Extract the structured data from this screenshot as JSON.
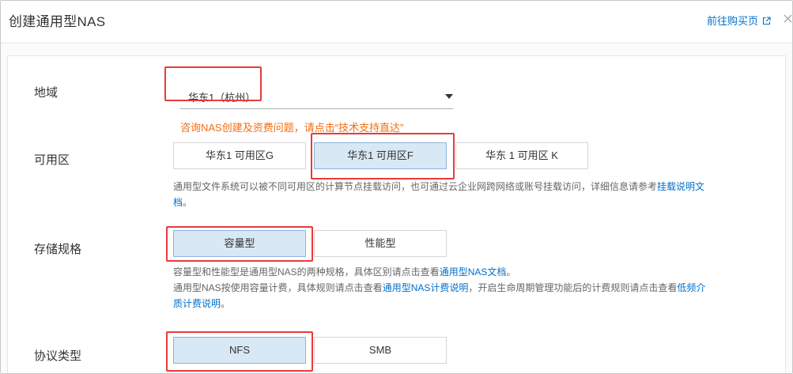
{
  "header": {
    "title": "创建通用型NAS",
    "buy_link": "前往购买页"
  },
  "region": {
    "label": "地域",
    "value": "华东1（杭州）",
    "hint": "咨询NAS创建及资费问题，请点击“技术支持直达”"
  },
  "zone": {
    "label": "可用区",
    "options": [
      "华东1 可用区G",
      "华东1 可用区F",
      "华东 1 可用区 K"
    ],
    "desc_text": "通用型文件系统可以被不同可用区的计算节点挂载访问，也可通过云企业网跨网络或账号挂载访问，详细信息请参考",
    "desc_link_1": "挂载说明文",
    "desc_link_2": "档",
    "desc_end": "。"
  },
  "storage": {
    "label": "存储规格",
    "options": [
      "容量型",
      "性能型"
    ],
    "desc1_text": "容量型和性能型是通用型NAS的两种规格，具体区别请点击查看",
    "desc1_link": "通用型NAS文档",
    "desc1_end": "。",
    "desc2_text": "通用型NAS按使用容量计费，具体规则请点击查看",
    "desc2_link": "通用型NAS计费说明",
    "desc2_mid": "，开启生命周期管理功能后的计费规则请点击查看",
    "desc2_link2a": "低频介",
    "desc2_link2b": "质计费说明",
    "desc2_end": "。"
  },
  "protocol": {
    "label": "协议类型",
    "options": [
      "NFS",
      "SMB"
    ]
  },
  "icons": {
    "external": "external-link-icon",
    "caret": "caret-down-icon",
    "close": "close-icon"
  },
  "colors": {
    "accent": "#0070cc",
    "warning": "#f56c0e",
    "selected_bg": "#d8e8f5",
    "highlight": "#e63c3c"
  }
}
